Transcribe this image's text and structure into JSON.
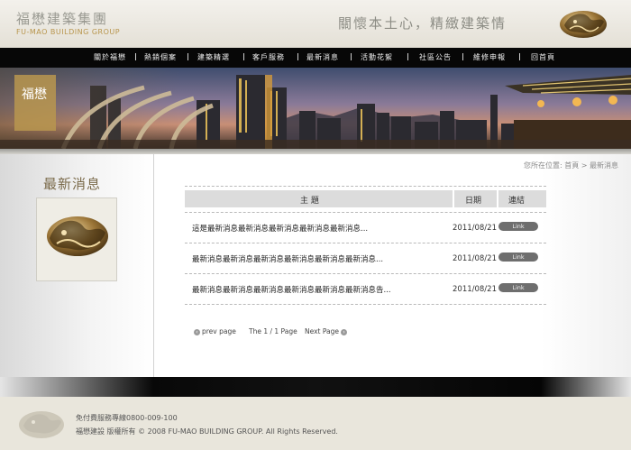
{
  "header": {
    "brand_cn": "福懋建築集團",
    "brand_en": "FU-MAO BUILDING GROUP",
    "slogan": "關懷本土心，精緻建築情"
  },
  "nav": {
    "items": [
      {
        "label": "關於福懋"
      },
      {
        "label": "熱銷個案"
      },
      {
        "label": "建築精選"
      },
      {
        "label": "客戶服務"
      },
      {
        "label": "最新消息"
      },
      {
        "label": "活動花絮"
      },
      {
        "label": "社區公告"
      },
      {
        "label": "維修申報"
      },
      {
        "label": "回首頁"
      }
    ]
  },
  "banner": {
    "emblem_text": "福懋"
  },
  "sidebar": {
    "title": "最新消息"
  },
  "breadcrumb": {
    "prefix": "您所在位置:",
    "home": "首頁",
    "separator": ">",
    "current": "最新消息"
  },
  "table": {
    "headers": {
      "subject": "主 題",
      "date": "日期",
      "link": "連結"
    },
    "rows": [
      {
        "title": "這是最新消息最新消息最新消息最新消息最新消息...",
        "date": "2011/08/21",
        "link_label": "Link"
      },
      {
        "title": "最新消息最新消息最新消息最新消息最新消息最新消息...",
        "date": "2011/08/21",
        "link_label": "Link"
      },
      {
        "title": "最新消息最新消息最新消息最新消息最新消息最新消息告...",
        "date": "2011/08/21",
        "link_label": "Link"
      }
    ]
  },
  "pager": {
    "prev": "prev page",
    "status": "The 1 / 1 Page",
    "next": "Next Page"
  },
  "footer": {
    "hotline": "免付費服務專線0800-009-100",
    "copyright": "福懋建設  版權所有 © 2008 FU-MAO BUILDING GROUP. All Rights Reserved."
  },
  "colors": {
    "nav_bg": "#070707",
    "brand_gold": "#b8954c",
    "footer_bg": "#e9e6dc",
    "link_pill": "#6e6e6e"
  }
}
